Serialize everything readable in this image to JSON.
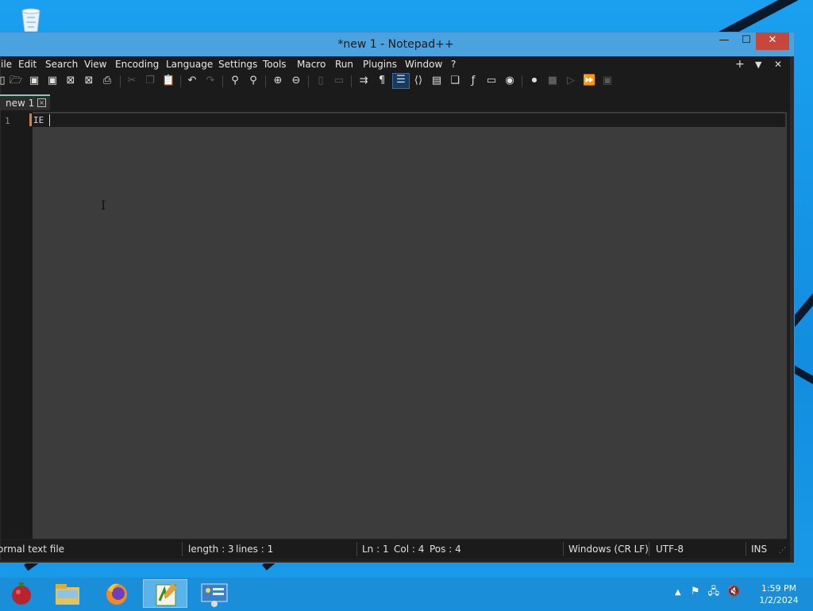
{
  "window": {
    "title": "*new 1 - Notepad++",
    "minimize_label": "—",
    "maximize_label": "☐",
    "close_label": "✕"
  },
  "menu": {
    "items": [
      "ile",
      "Edit",
      "Search",
      "View",
      "Encoding",
      "Language",
      "Settings",
      "Tools",
      "Macro",
      "Run",
      "Plugins",
      "Window",
      "?"
    ],
    "right": [
      "+",
      "▼",
      "✕"
    ]
  },
  "toolbar": {
    "icons": [
      "new-file-icon",
      "open-file-icon",
      "save-icon",
      "save-all-icon",
      "close-icon",
      "close-all-icon",
      "print-icon",
      "cut-icon",
      "copy-icon",
      "paste-icon",
      "undo-icon",
      "redo-icon",
      "find-icon",
      "replace-icon",
      "zoom-in-icon",
      "zoom-out-icon",
      "sync-vertical-icon",
      "sync-horizontal-icon",
      "word-wrap-icon",
      "show-all-characters-icon",
      "indent-guide-icon",
      "xml-tag-icon",
      "document-map-icon",
      "document-list-icon",
      "function-list-icon",
      "folder-as-workspace-icon",
      "monitoring-icon",
      "macro-record-icon",
      "macro-stop-icon",
      "macro-play-icon",
      "macro-run-multiple-icon",
      "macro-save-icon"
    ]
  },
  "tab": {
    "label": "new 1",
    "close_label": "×"
  },
  "editor": {
    "line_number": "1",
    "content": "IE"
  },
  "status": {
    "file_type": "ormal text file",
    "length": "length : 3",
    "lines": "lines : 1",
    "ln": "Ln : 1",
    "col": "Col : 4",
    "pos": "Pos : 4",
    "eol": "Windows (CR LF)",
    "encoding": "UTF-8",
    "mode": "INS"
  },
  "taskbar": {
    "apps": [
      "app-icon",
      "file-explorer-icon",
      "firefox-icon",
      "notepad-plus-plus-icon",
      "control-panel-icon"
    ],
    "active_app": "notepad-plus-plus-icon",
    "clock_time": "1:59 PM",
    "clock_date": "1/2/2024"
  },
  "colors": {
    "accent": "#4aa3df",
    "close_button": "#c7473c",
    "editor_bg": "#3c3c3c",
    "tab_accent": "#87c7c0",
    "line_marker": "#e6783a"
  }
}
